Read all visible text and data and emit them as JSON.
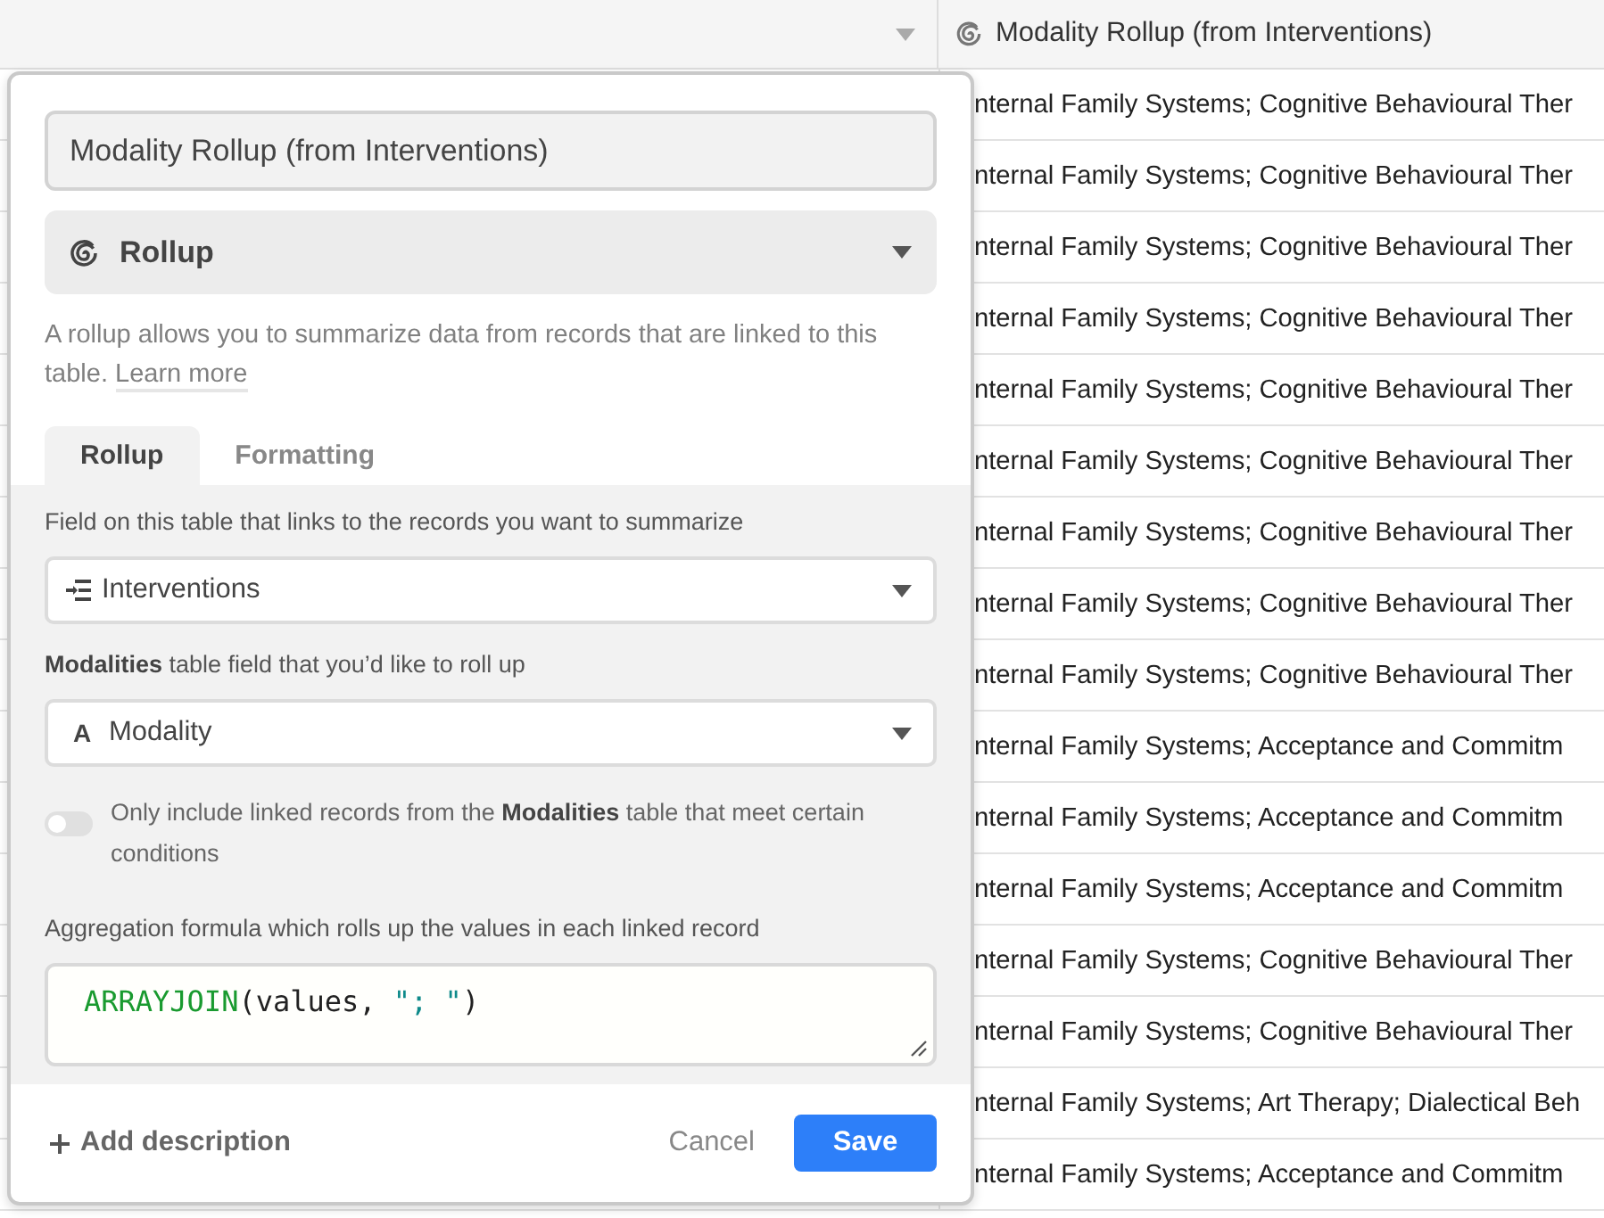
{
  "grid": {
    "column": {
      "name": "Modality Rollup (from Interventions)"
    },
    "rows": [
      {
        "value": "nternal Family Systems; Cognitive Behavioural Ther"
      },
      {
        "value": "nternal Family Systems; Cognitive Behavioural Ther"
      },
      {
        "value": "nternal Family Systems; Cognitive Behavioural Ther"
      },
      {
        "value": "nternal Family Systems; Cognitive Behavioural Ther"
      },
      {
        "value": "nternal Family Systems; Cognitive Behavioural Ther"
      },
      {
        "value": "nternal Family Systems; Cognitive Behavioural Ther"
      },
      {
        "value": "nternal Family Systems; Cognitive Behavioural Ther"
      },
      {
        "value": "nternal Family Systems; Cognitive Behavioural Ther"
      },
      {
        "value": "nternal Family Systems; Cognitive Behavioural Ther"
      },
      {
        "value": "nternal Family Systems; Acceptance and Commitm"
      },
      {
        "value": "nternal Family Systems; Acceptance and Commitm"
      },
      {
        "value": "nternal Family Systems; Acceptance and Commitm"
      },
      {
        "value": "nternal Family Systems; Cognitive Behavioural Ther"
      },
      {
        "value": "nternal Family Systems; Cognitive Behavioural Ther"
      },
      {
        "value": "nternal Family Systems; Art Therapy; Dialectical Beh"
      },
      {
        "value": "nternal Family Systems; Acceptance and Commitm"
      }
    ]
  },
  "dialog": {
    "name_value": "Modality Rollup (from Interventions)",
    "field_type": "Rollup",
    "description": {
      "text": "A rollup allows you to summarize data from records that are linked to this table.",
      "link": "Learn more"
    },
    "tabs": [
      {
        "label": "Rollup",
        "selected": true
      },
      {
        "label": "Formatting",
        "selected": false
      }
    ],
    "link_label": "Field on this table that links to the records you want to summarize",
    "link_field": {
      "value": "Interventions"
    },
    "rollup_label": "**Modalities** table field that you’d like to roll up",
    "rollup_field": {
      "glyph": "A",
      "value": "Modality"
    },
    "condition": {
      "on": false,
      "label": "Only include linked records from the **Modalities** table that meet certain conditions"
    },
    "formula_label": "Aggregation formula which rolls up the values in each linked record",
    "formula": [
      {
        "kind": "function",
        "text": "ARRAYJOIN"
      },
      {
        "kind": "plain",
        "text": "(values, "
      },
      {
        "kind": "string",
        "text": "\"; \""
      },
      {
        "kind": "plain",
        "text": ")"
      }
    ],
    "add_description": "Add description",
    "cancel": "Cancel",
    "save": "Save"
  }
}
